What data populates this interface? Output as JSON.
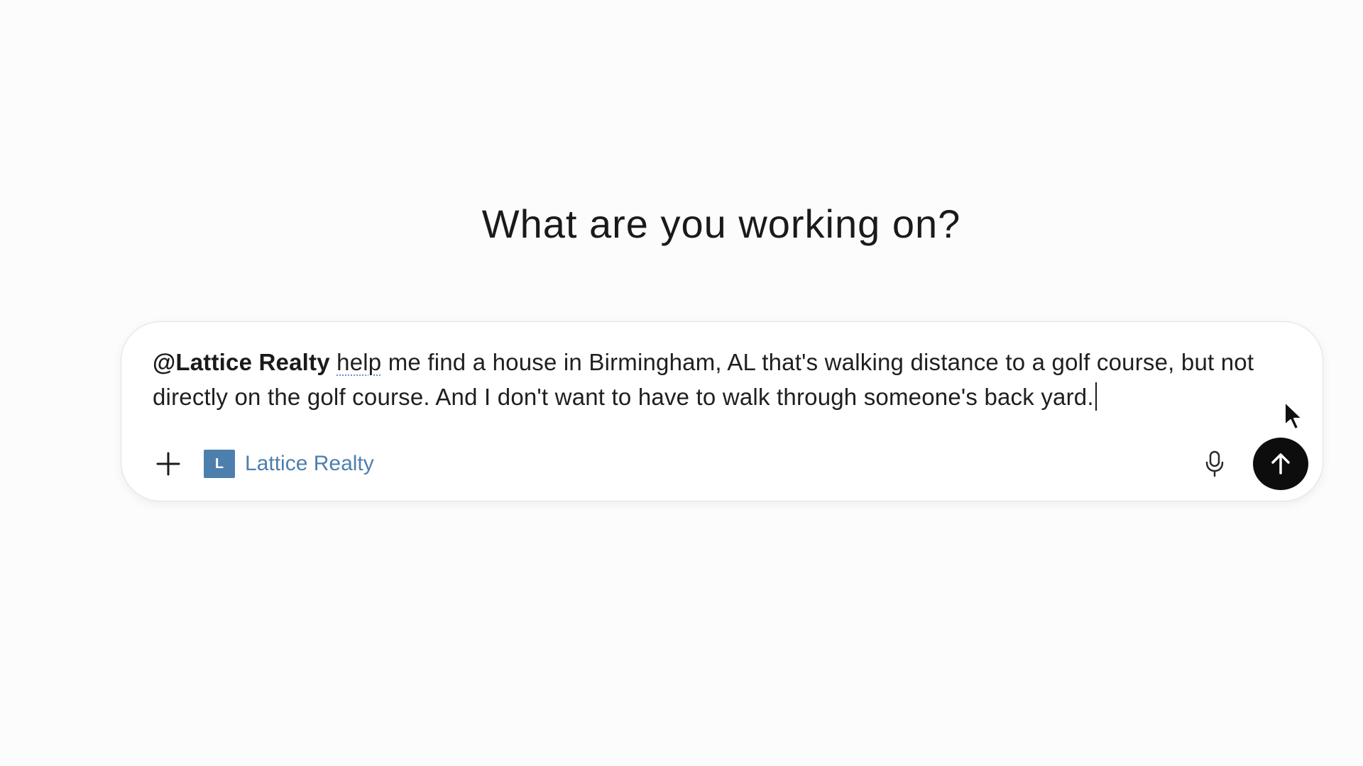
{
  "heading": "What are you working on?",
  "composer": {
    "mention": "@Lattice Realty",
    "misspelled_word": "help",
    "text_after": " me find a house in Birmingham, AL that's walking distance to a golf course, but not directly on the golf course. And I don't want to have to walk through someone's back yard."
  },
  "toolbar": {
    "add_icon": "plus-icon",
    "chip": {
      "badge_letter": "L",
      "label": "Lattice Realty",
      "color": "#4d7fae"
    },
    "mic_icon": "microphone-icon",
    "send_icon": "arrow-up-icon"
  },
  "colors": {
    "background": "#fcfcfc",
    "send_button": "#0d0d0d",
    "accent": "#4d7fae"
  }
}
